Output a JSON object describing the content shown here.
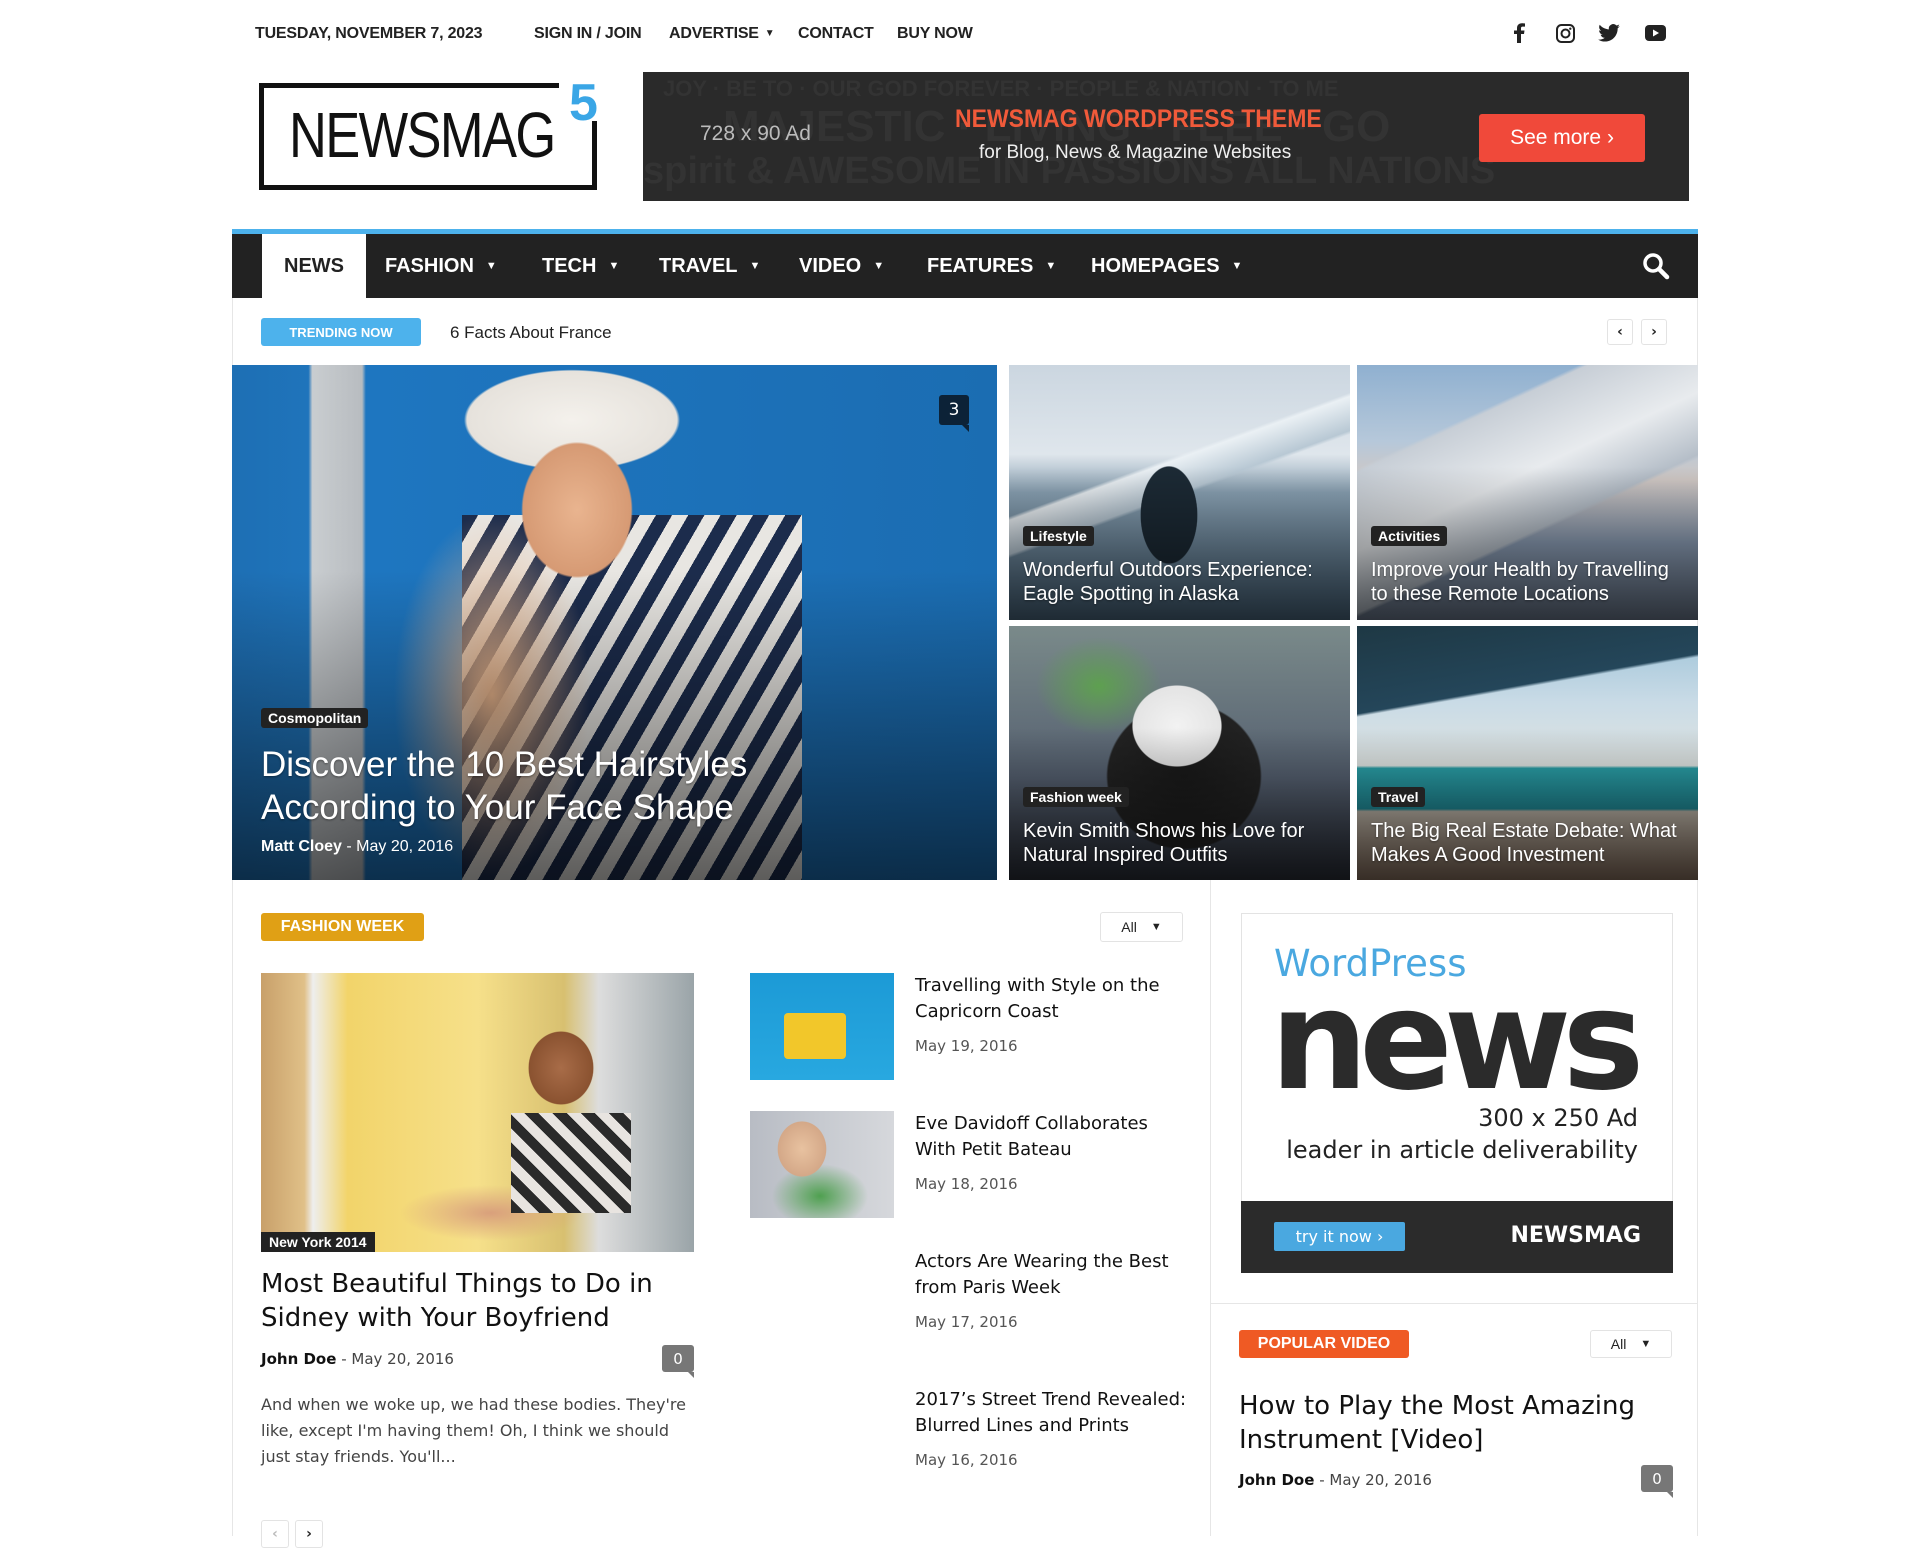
{
  "topbar": {
    "date": "TUESDAY, NOVEMBER 7, 2023",
    "links": [
      {
        "label": "SIGN IN / JOIN",
        "dropdown": false
      },
      {
        "label": "ADVERTISE",
        "dropdown": true
      },
      {
        "label": "CONTACT",
        "dropdown": false
      },
      {
        "label": "BUY NOW",
        "dropdown": false
      }
    ],
    "social": [
      "facebook-icon",
      "instagram-icon",
      "twitter-icon",
      "youtube-icon"
    ]
  },
  "logo": {
    "word": "NEWSMAG",
    "version": "5",
    "accent": "#3aa6e6"
  },
  "header_ad": {
    "size": "728 x 90 Ad",
    "title": "NEWSMAG WORDPRESS THEME",
    "subtitle": "for Blog, News & Magazine Websites",
    "button": "See more ›",
    "title_color": "#f05a3a",
    "button_color": "#f0493a"
  },
  "nav": {
    "items": [
      {
        "label": "NEWS",
        "active": true,
        "dropdown": false
      },
      {
        "label": "FASHION",
        "dropdown": true
      },
      {
        "label": "TECH",
        "dropdown": true
      },
      {
        "label": "TRAVEL",
        "dropdown": true
      },
      {
        "label": "VIDEO",
        "dropdown": true
      },
      {
        "label": "FEATURES",
        "dropdown": true
      },
      {
        "label": "HOMEPAGES",
        "dropdown": true
      }
    ],
    "accent": "#4db2ec",
    "background": "#222222"
  },
  "trending": {
    "label": "TRENDING NOW",
    "text": "6 Facts About France",
    "prev": "‹",
    "next": "›"
  },
  "hero": {
    "main": {
      "category": "Cosmopolitan",
      "title": "Discover the 10 Best Hairstyles According to Your Face Shape",
      "author": "Matt Cloey",
      "separator": "-",
      "date": "May 20, 2016",
      "comments": "3"
    },
    "tiles": [
      {
        "category": "Lifestyle",
        "title": "Wonderful Outdoors Experience: Eagle Spotting in Alaska"
      },
      {
        "category": "Activities",
        "title": "Improve your Health by Travelling to these Remote Locations"
      },
      {
        "category": "Fashion week",
        "title": "Kevin Smith Shows his Love for Natural Inspired Outfits"
      },
      {
        "category": "Travel",
        "title": "The Big Real Estate Debate: What Makes A Good Investment"
      }
    ]
  },
  "fashion_week": {
    "label": "FASHION WEEK",
    "color": "#e0a015",
    "filter": "All",
    "featured": {
      "image_caption": "New York 2014",
      "title": "Most Beautiful Things to Do in Sidney with Your Boyfriend",
      "author": "John Doe",
      "separator": "-",
      "date": "May 20, 2016",
      "comments": "0",
      "excerpt": "And when we woke up, we had these bodies. They're like, except I'm having them! Oh, I think we should just stay friends. You'll..."
    },
    "list": [
      {
        "title": "Travelling with Style on the Capricorn Coast",
        "date": "May 19, 2016",
        "has_thumb": true
      },
      {
        "title": "Eve Davidoff Collaborates With Petit Bateau",
        "date": "May 18, 2016",
        "has_thumb": true
      },
      {
        "title": "Actors Are Wearing the Best from Paris Week",
        "date": "May 17, 2016",
        "has_thumb": false
      },
      {
        "title": "2017’s Street Trend Revealed: Blurred Lines and Prints",
        "date": "May 16, 2016",
        "has_thumb": false
      }
    ],
    "prev": "‹",
    "next": "›"
  },
  "side_ad": {
    "wordpress": "WordPress",
    "news": "news",
    "size": "300 x 250 Ad",
    "tagline": "leader in article deliverability",
    "button": "try it now ›",
    "brand": "NEWSMAG"
  },
  "popular_video": {
    "label": "POPULAR VIDEO",
    "color": "#ef5a24",
    "filter": "All",
    "title": "How to Play the Most Amazing Instrument [Video]",
    "author": "John Doe",
    "separator": "-",
    "date": "May 20, 2016",
    "comments": "0"
  }
}
